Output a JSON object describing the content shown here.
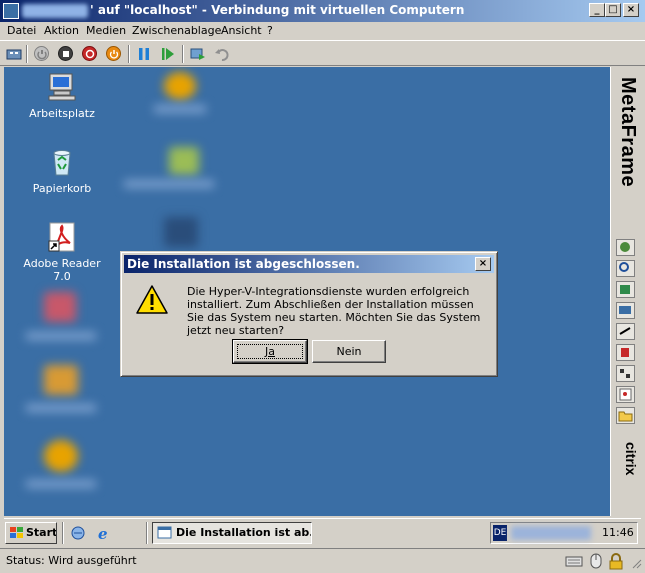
{
  "window": {
    "title": "' auf \"localhost\" - Verbindung mit virtuellen Computern",
    "controls": [
      "_",
      "□",
      "×"
    ]
  },
  "menu": [
    "Datei",
    "Aktion",
    "Medien",
    "Zwischenablage",
    "Ansicht",
    "?"
  ],
  "toolbar": {
    "icons": [
      "ctrl-alt-del-icon",
      "start-icon",
      "stop-icon",
      "shutdown-icon",
      "power-icon",
      "pause-icon",
      "resume-icon",
      "snapshot-icon",
      "revert-icon"
    ]
  },
  "desktop": {
    "icons": [
      {
        "label": "Arbeitsplatz",
        "icon": "my-computer-icon"
      },
      {
        "label": "Papierkorb",
        "icon": "recycle-bin-icon"
      },
      {
        "label": "Adobe Reader 7.0",
        "icon": "adobe-reader-icon"
      }
    ]
  },
  "citrix": {
    "brand": "MetaFrame",
    "logo": "citrix"
  },
  "dialog": {
    "title": "Die Installation ist abgeschlossen.",
    "close": "×",
    "message": "Die Hyper-V-Integrationsdienste wurden erfolgreich installiert. Zum Abschließen der Installation müssen Sie das System neu starten. Möchten Sie das System jetzt neu starten?",
    "yes": "Ja",
    "no": "Nein"
  },
  "taskbar": {
    "start": "Start",
    "task": "Die Installation ist ab...",
    "lang": "DE",
    "clock": "11:46"
  },
  "status": {
    "text": "Status: Wird ausgeführt"
  },
  "colors": {
    "desktop": "#3a6ea5",
    "title_start": "#0a246a",
    "title_end": "#a6caf0"
  }
}
